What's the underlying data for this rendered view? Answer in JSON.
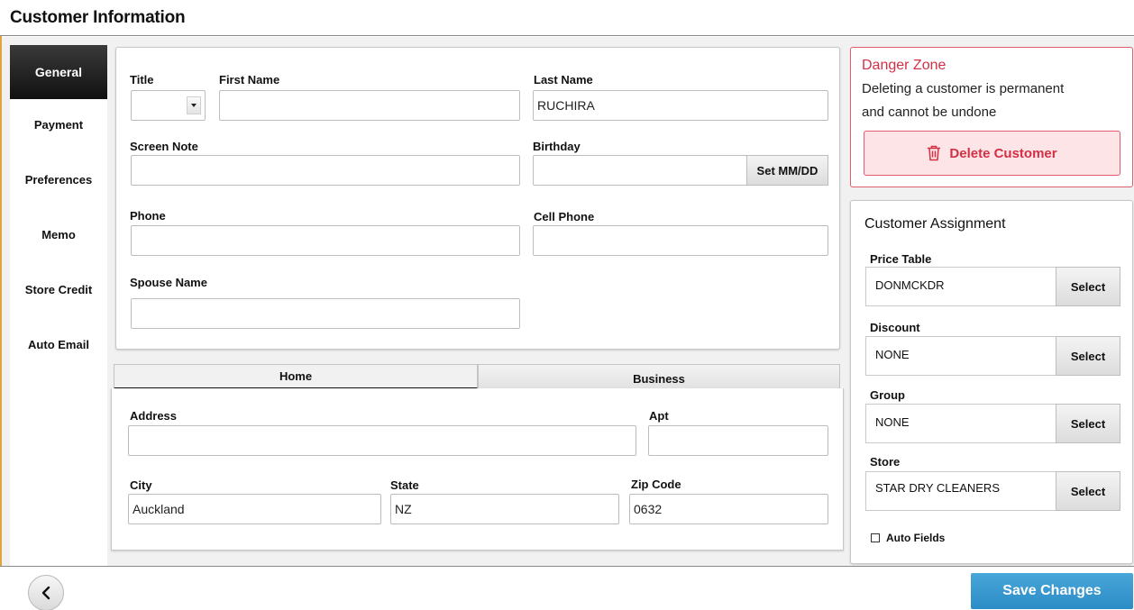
{
  "window": {
    "title": "Customer Information"
  },
  "sidenav": {
    "items": [
      {
        "label": "General",
        "active": true
      },
      {
        "label": "Payment"
      },
      {
        "label": "Preferences"
      },
      {
        "label": "Memo"
      },
      {
        "label": "Store Credit"
      },
      {
        "label": "Auto Email"
      }
    ]
  },
  "general": {
    "title_label": "Title",
    "title_value": "",
    "first_name_label": "First Name",
    "first_name_value": "",
    "last_name_label": "Last Name",
    "last_name_value": "RUCHIRA",
    "screen_note_label": "Screen Note",
    "screen_note_value": "",
    "birthday_label": "Birthday",
    "birthday_value": "",
    "birthday_button": "Set MM/DD",
    "phone_label": "Phone",
    "phone_value": "",
    "cell_phone_label": "Cell Phone",
    "cell_phone_value": "",
    "spouse_label": "Spouse Name",
    "spouse_value": ""
  },
  "address_tabs": [
    {
      "label": "Home",
      "active": true
    },
    {
      "label": "Business"
    }
  ],
  "address": {
    "address_label": "Address",
    "address_value": "",
    "apt_label": "Apt",
    "apt_value": "",
    "city_label": "City",
    "city_value": "Auckland",
    "state_label": "State",
    "state_value": "NZ",
    "zip_label": "Zip Code",
    "zip_value": "0632"
  },
  "danger": {
    "title": "Danger Zone",
    "line1": "Deleting a customer is permanent",
    "line2": "and cannot be undone",
    "delete_label": "Delete Customer"
  },
  "assignment": {
    "title": "Customer Assignment",
    "select_label": "Select",
    "rows": [
      {
        "label": "Price Table",
        "value": "DONMCKDR"
      },
      {
        "label": "Discount",
        "value": "NONE"
      },
      {
        "label": "Group",
        "value": "NONE"
      },
      {
        "label": "Store",
        "value": "STAR DRY CLEANERS"
      }
    ],
    "auto_fields_label": "Auto Fields",
    "auto_fields_checked": false
  },
  "footer": {
    "save_label": "Save Changes"
  },
  "colors": {
    "accent": "#2c8cc6",
    "danger": "#d32f45",
    "danger_bg": "#fde4e7",
    "nav_active": "#1c1c1c"
  }
}
